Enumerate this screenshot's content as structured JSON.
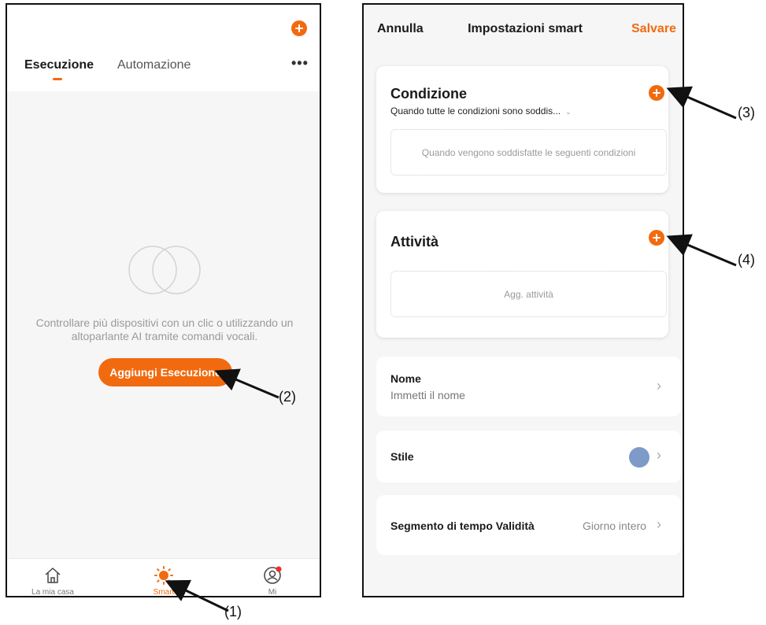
{
  "left_screen": {
    "tabs": [
      {
        "label": "Esecuzione",
        "active": true
      },
      {
        "label": "Automazione",
        "active": false
      }
    ],
    "more_icon": "more-dots-icon",
    "empty_message": "Controllare più dispositivi con un clic o utilizzando un altoparlante AI tramite comandi vocali.",
    "add_button_label": "Aggiungi Esecuzione",
    "bottom_nav": [
      {
        "label": "La mia casa",
        "icon": "home-icon"
      },
      {
        "label": "Smart",
        "icon": "sun-icon",
        "active": true
      },
      {
        "label": "Mi",
        "icon": "profile-icon",
        "badge": true
      }
    ]
  },
  "right_screen": {
    "header": {
      "cancel": "Annulla",
      "title": "Impostazioni smart",
      "save": "Salvare"
    },
    "condition_card": {
      "title": "Condizione",
      "selector": "Quando tutte le condizioni sono soddis...",
      "placeholder": "Quando vengono soddisfatte le seguenti condizioni"
    },
    "task_card": {
      "title": "Attività",
      "placeholder": "Agg. attività"
    },
    "rows": {
      "name": {
        "label": "Nome",
        "value": "Immetti il nome"
      },
      "style": {
        "label": "Stile",
        "color": "#7d9ac9"
      },
      "validity": {
        "label": "Segmento di tempo Validità",
        "value": "Giorno intero"
      }
    }
  },
  "annotations": [
    "(1)",
    "(2)",
    "(3)",
    "(4)"
  ],
  "colors": {
    "accent": "#f26a0f",
    "style_dot": "#7d9ac9"
  }
}
